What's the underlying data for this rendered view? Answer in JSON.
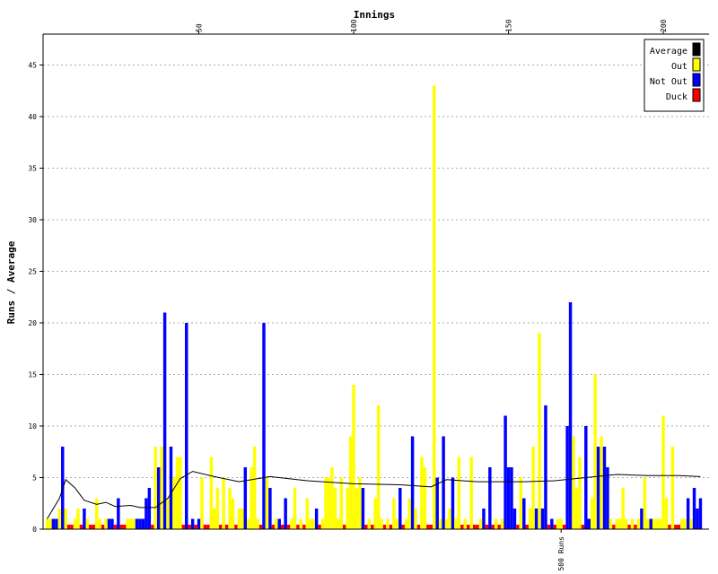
{
  "chart_data": {
    "type": "bar",
    "title": "",
    "xlabel": "Innings",
    "ylabel": "Runs / Average",
    "x_range": [
      1,
      216
    ],
    "ylim": [
      0,
      48
    ],
    "y_ticks": [
      0,
      5,
      10,
      15,
      20,
      25,
      30,
      35,
      40,
      45
    ],
    "x_ticks": [
      50,
      100,
      150,
      200
    ],
    "grid": "horizontal dotted",
    "legend_position": "top-right",
    "legend": [
      {
        "label": "Average",
        "color": "#000000"
      },
      {
        "label": "Out",
        "color": "#ffff00"
      },
      {
        "label": "Not Out",
        "color": "#0000ff"
      },
      {
        "label": "Duck",
        "color": "#ff0000"
      }
    ],
    "annotations": [
      {
        "text": "500 Runs",
        "innings": 167
      }
    ],
    "innings": [
      {
        "n": 1,
        "type": "Out",
        "runs": 1
      },
      {
        "n": 2,
        "type": "Out",
        "runs": 1
      },
      {
        "n": 3,
        "type": "Not Out",
        "runs": 1
      },
      {
        "n": 4,
        "type": "Not Out",
        "runs": 1
      },
      {
        "n": 5,
        "type": "Out",
        "runs": 2
      },
      {
        "n": 6,
        "type": "Not Out",
        "runs": 8
      },
      {
        "n": 7,
        "type": "Out",
        "runs": 2
      },
      {
        "n": 8,
        "type": "Duck",
        "runs": 0
      },
      {
        "n": 9,
        "type": "Duck",
        "runs": 0
      },
      {
        "n": 10,
        "type": "Out",
        "runs": 1
      },
      {
        "n": 11,
        "type": "Out",
        "runs": 2
      },
      {
        "n": 12,
        "type": "Duck",
        "runs": 0
      },
      {
        "n": 13,
        "type": "Not Out",
        "runs": 2
      },
      {
        "n": 14,
        "type": "Out",
        "runs": 1
      },
      {
        "n": 15,
        "type": "Duck",
        "runs": 0
      },
      {
        "n": 16,
        "type": "Duck",
        "runs": 0
      },
      {
        "n": 17,
        "type": "Out",
        "runs": 3
      },
      {
        "n": 18,
        "type": "Out",
        "runs": 1
      },
      {
        "n": 19,
        "type": "Duck",
        "runs": 0
      },
      {
        "n": 20,
        "type": "Out",
        "runs": 1
      },
      {
        "n": 21,
        "type": "Not Out",
        "runs": 1
      },
      {
        "n": 22,
        "type": "Not Out",
        "runs": 1
      },
      {
        "n": 23,
        "type": "Duck",
        "runs": 0
      },
      {
        "n": 24,
        "type": "Not Out",
        "runs": 3
      },
      {
        "n": 25,
        "type": "Duck",
        "runs": 0
      },
      {
        "n": 26,
        "type": "Duck",
        "runs": 0
      },
      {
        "n": 27,
        "type": "Out",
        "runs": 1
      },
      {
        "n": 28,
        "type": "Out",
        "runs": 1
      },
      {
        "n": 29,
        "type": "Out",
        "runs": 1
      },
      {
        "n": 30,
        "type": "Not Out",
        "runs": 1
      },
      {
        "n": 31,
        "type": "Not Out",
        "runs": 1
      },
      {
        "n": 32,
        "type": "Not Out",
        "runs": 1
      },
      {
        "n": 33,
        "type": "Not Out",
        "runs": 3
      },
      {
        "n": 34,
        "type": "Not Out",
        "runs": 4
      },
      {
        "n": 35,
        "type": "Duck",
        "runs": 0
      },
      {
        "n": 36,
        "type": "Out",
        "runs": 8
      },
      {
        "n": 37,
        "type": "Not Out",
        "runs": 6
      },
      {
        "n": 38,
        "type": "Out",
        "runs": 8
      },
      {
        "n": 39,
        "type": "Not Out",
        "runs": 21
      },
      {
        "n": 40,
        "type": "Out",
        "runs": 3
      },
      {
        "n": 41,
        "type": "Not Out",
        "runs": 8
      },
      {
        "n": 42,
        "type": "Out",
        "runs": 5
      },
      {
        "n": 43,
        "type": "Out",
        "runs": 7
      },
      {
        "n": 44,
        "type": "Out",
        "runs": 7
      },
      {
        "n": 45,
        "type": "Duck",
        "runs": 0
      },
      {
        "n": 46,
        "type": "Not Out",
        "runs": 20
      },
      {
        "n": 47,
        "type": "Duck",
        "runs": 0
      },
      {
        "n": 48,
        "type": "Not Out",
        "runs": 1
      },
      {
        "n": 49,
        "type": "Duck",
        "runs": 0
      },
      {
        "n": 50,
        "type": "Not Out",
        "runs": 1
      },
      {
        "n": 51,
        "type": "Out",
        "runs": 5
      },
      {
        "n": 52,
        "type": "Duck",
        "runs": 0
      },
      {
        "n": 53,
        "type": "Duck",
        "runs": 0
      },
      {
        "n": 54,
        "type": "Out",
        "runs": 7
      },
      {
        "n": 55,
        "type": "Out",
        "runs": 2
      },
      {
        "n": 56,
        "type": "Out",
        "runs": 4
      },
      {
        "n": 57,
        "type": "Duck",
        "runs": 0
      },
      {
        "n": 58,
        "type": "Out",
        "runs": 5
      },
      {
        "n": 59,
        "type": "Duck",
        "runs": 0
      },
      {
        "n": 60,
        "type": "Out",
        "runs": 4
      },
      {
        "n": 61,
        "type": "Out",
        "runs": 3
      },
      {
        "n": 62,
        "type": "Duck",
        "runs": 0
      },
      {
        "n": 63,
        "type": "Out",
        "runs": 2
      },
      {
        "n": 64,
        "type": "Out",
        "runs": 2
      },
      {
        "n": 65,
        "type": "Not Out",
        "runs": 6
      },
      {
        "n": 66,
        "type": "Out",
        "runs": 1
      },
      {
        "n": 67,
        "type": "Out",
        "runs": 6
      },
      {
        "n": 68,
        "type": "Out",
        "runs": 8
      },
      {
        "n": 69,
        "type": "Out",
        "runs": 1
      },
      {
        "n": 70,
        "type": "Duck",
        "runs": 0
      },
      {
        "n": 71,
        "type": "Not Out",
        "runs": 20
      },
      {
        "n": 72,
        "type": "Out",
        "runs": 5
      },
      {
        "n": 73,
        "type": "Not Out",
        "runs": 4
      },
      {
        "n": 74,
        "type": "Duck",
        "runs": 0
      },
      {
        "n": 75,
        "type": "Out",
        "runs": 1
      },
      {
        "n": 76,
        "type": "Not Out",
        "runs": 1
      },
      {
        "n": 77,
        "type": "Duck",
        "runs": 0
      },
      {
        "n": 78,
        "type": "Not Out",
        "runs": 3
      },
      {
        "n": 79,
        "type": "Duck",
        "runs": 0
      },
      {
        "n": 80,
        "type": "Out",
        "runs": 1
      },
      {
        "n": 81,
        "type": "Out",
        "runs": 4
      },
      {
        "n": 82,
        "type": "Duck",
        "runs": 0
      },
      {
        "n": 83,
        "type": "Out",
        "runs": 1
      },
      {
        "n": 84,
        "type": "Duck",
        "runs": 0
      },
      {
        "n": 85,
        "type": "Out",
        "runs": 3
      },
      {
        "n": 86,
        "type": "Out",
        "runs": 1
      },
      {
        "n": 87,
        "type": "Out",
        "runs": 1
      },
      {
        "n": 88,
        "type": "Not Out",
        "runs": 2
      },
      {
        "n": 89,
        "type": "Duck",
        "runs": 0
      },
      {
        "n": 90,
        "type": "Out",
        "runs": 1
      },
      {
        "n": 91,
        "type": "Out",
        "runs": 5
      },
      {
        "n": 92,
        "type": "Out",
        "runs": 5
      },
      {
        "n": 93,
        "type": "Out",
        "runs": 6
      },
      {
        "n": 94,
        "type": "Out",
        "runs": 4
      },
      {
        "n": 95,
        "type": "Out",
        "runs": 1
      },
      {
        "n": 96,
        "type": "Out",
        "runs": 5
      },
      {
        "n": 97,
        "type": "Duck",
        "runs": 0
      },
      {
        "n": 98,
        "type": "Out",
        "runs": 4
      },
      {
        "n": 99,
        "type": "Out",
        "runs": 9
      },
      {
        "n": 100,
        "type": "Out",
        "runs": 14
      },
      {
        "n": 101,
        "type": "Out",
        "runs": 4
      },
      {
        "n": 102,
        "type": "Out",
        "runs": 5
      },
      {
        "n": 103,
        "type": "Not Out",
        "runs": 4
      },
      {
        "n": 104,
        "type": "Duck",
        "runs": 0
      },
      {
        "n": 105,
        "type": "Out",
        "runs": 1
      },
      {
        "n": 106,
        "type": "Duck",
        "runs": 0
      },
      {
        "n": 107,
        "type": "Out",
        "runs": 3
      },
      {
        "n": 108,
        "type": "Out",
        "runs": 12
      },
      {
        "n": 109,
        "type": "Out",
        "runs": 1
      },
      {
        "n": 110,
        "type": "Duck",
        "runs": 0
      },
      {
        "n": 111,
        "type": "Out",
        "runs": 1
      },
      {
        "n": 112,
        "type": "Duck",
        "runs": 0
      },
      {
        "n": 113,
        "type": "Out",
        "runs": 3
      },
      {
        "n": 114,
        "type": "Out",
        "runs": 1
      },
      {
        "n": 115,
        "type": "Not Out",
        "runs": 4
      },
      {
        "n": 116,
        "type": "Duck",
        "runs": 0
      },
      {
        "n": 117,
        "type": "Out",
        "runs": 1
      },
      {
        "n": 118,
        "type": "Out",
        "runs": 3
      },
      {
        "n": 119,
        "type": "Not Out",
        "runs": 9
      },
      {
        "n": 120,
        "type": "Out",
        "runs": 2
      },
      {
        "n": 121,
        "type": "Duck",
        "runs": 0
      },
      {
        "n": 122,
        "type": "Out",
        "runs": 7
      },
      {
        "n": 123,
        "type": "Out",
        "runs": 6
      },
      {
        "n": 124,
        "type": "Duck",
        "runs": 0
      },
      {
        "n": 125,
        "type": "Duck",
        "runs": 0
      },
      {
        "n": 126,
        "type": "Out",
        "runs": 43
      },
      {
        "n": 127,
        "type": "Not Out",
        "runs": 5
      },
      {
        "n": 128,
        "type": "Out",
        "runs": 1
      },
      {
        "n": 129,
        "type": "Not Out",
        "runs": 9
      },
      {
        "n": 130,
        "type": "Out",
        "runs": 1
      },
      {
        "n": 131,
        "type": "Out",
        "runs": 2
      },
      {
        "n": 132,
        "type": "Not Out",
        "runs": 5
      },
      {
        "n": 133,
        "type": "Out",
        "runs": 1
      },
      {
        "n": 134,
        "type": "Out",
        "runs": 7
      },
      {
        "n": 135,
        "type": "Duck",
        "runs": 0
      },
      {
        "n": 136,
        "type": "Out",
        "runs": 1
      },
      {
        "n": 137,
        "type": "Duck",
        "runs": 0
      },
      {
        "n": 138,
        "type": "Out",
        "runs": 7
      },
      {
        "n": 139,
        "type": "Duck",
        "runs": 0
      },
      {
        "n": 140,
        "type": "Duck",
        "runs": 0
      },
      {
        "n": 141,
        "type": "Out",
        "runs": 1
      },
      {
        "n": 142,
        "type": "Not Out",
        "runs": 2
      },
      {
        "n": 143,
        "type": "Duck",
        "runs": 0
      },
      {
        "n": 144,
        "type": "Not Out",
        "runs": 6
      },
      {
        "n": 145,
        "type": "Duck",
        "runs": 0
      },
      {
        "n": 146,
        "type": "Out",
        "runs": 1
      },
      {
        "n": 147,
        "type": "Duck",
        "runs": 0
      },
      {
        "n": 148,
        "type": "Out",
        "runs": 1
      },
      {
        "n": 149,
        "type": "Not Out",
        "runs": 11
      },
      {
        "n": 150,
        "type": "Not Out",
        "runs": 6
      },
      {
        "n": 151,
        "type": "Not Out",
        "runs": 6
      },
      {
        "n": 152,
        "type": "Not Out",
        "runs": 2
      },
      {
        "n": 153,
        "type": "Duck",
        "runs": 0
      },
      {
        "n": 154,
        "type": "Out",
        "runs": 5
      },
      {
        "n": 155,
        "type": "Not Out",
        "runs": 3
      },
      {
        "n": 156,
        "type": "Duck",
        "runs": 0
      },
      {
        "n": 157,
        "type": "Out",
        "runs": 2
      },
      {
        "n": 158,
        "type": "Out",
        "runs": 8
      },
      {
        "n": 159,
        "type": "Not Out",
        "runs": 2
      },
      {
        "n": 160,
        "type": "Out",
        "runs": 19
      },
      {
        "n": 161,
        "type": "Not Out",
        "runs": 2
      },
      {
        "n": 162,
        "type": "Not Out",
        "runs": 12
      },
      {
        "n": 163,
        "type": "Duck",
        "runs": 0
      },
      {
        "n": 164,
        "type": "Not Out",
        "runs": 1
      },
      {
        "n": 165,
        "type": "Duck",
        "runs": 0
      },
      {
        "n": 166,
        "type": "Out",
        "runs": 1
      },
      {
        "n": 167,
        "type": "Out",
        "runs": 1
      },
      {
        "n": 168,
        "type": "Duck",
        "runs": 0
      },
      {
        "n": 169,
        "type": "Not Out",
        "runs": 10
      },
      {
        "n": 170,
        "type": "Not Out",
        "runs": 22
      },
      {
        "n": 171,
        "type": "Out",
        "runs": 9
      },
      {
        "n": 172,
        "type": "Out",
        "runs": 4
      },
      {
        "n": 173,
        "type": "Out",
        "runs": 7
      },
      {
        "n": 174,
        "type": "Duck",
        "runs": 0
      },
      {
        "n": 175,
        "type": "Not Out",
        "runs": 10
      },
      {
        "n": 176,
        "type": "Not Out",
        "runs": 1
      },
      {
        "n": 177,
        "type": "Out",
        "runs": 3
      },
      {
        "n": 178,
        "type": "Out",
        "runs": 15
      },
      {
        "n": 179,
        "type": "Not Out",
        "runs": 8
      },
      {
        "n": 180,
        "type": "Out",
        "runs": 9
      },
      {
        "n": 181,
        "type": "Not Out",
        "runs": 8
      },
      {
        "n": 182,
        "type": "Not Out",
        "runs": 6
      },
      {
        "n": 183,
        "type": "Out",
        "runs": 1
      },
      {
        "n": 184,
        "type": "Duck",
        "runs": 0
      },
      {
        "n": 185,
        "type": "Out",
        "runs": 1
      },
      {
        "n": 186,
        "type": "Out",
        "runs": 1
      },
      {
        "n": 187,
        "type": "Out",
        "runs": 4
      },
      {
        "n": 188,
        "type": "Out",
        "runs": 1
      },
      {
        "n": 189,
        "type": "Duck",
        "runs": 0
      },
      {
        "n": 190,
        "type": "Out",
        "runs": 1
      },
      {
        "n": 191,
        "type": "Duck",
        "runs": 0
      },
      {
        "n": 192,
        "type": "Out",
        "runs": 1
      },
      {
        "n": 193,
        "type": "Not Out",
        "runs": 2
      },
      {
        "n": 194,
        "type": "Out",
        "runs": 5
      },
      {
        "n": 195,
        "type": "Out",
        "runs": 1
      },
      {
        "n": 196,
        "type": "Not Out",
        "runs": 1
      },
      {
        "n": 197,
        "type": "Out",
        "runs": 1
      },
      {
        "n": 198,
        "type": "Out",
        "runs": 1
      },
      {
        "n": 199,
        "type": "Out",
        "runs": 1
      },
      {
        "n": 200,
        "type": "Out",
        "runs": 11
      },
      {
        "n": 201,
        "type": "Out",
        "runs": 3
      },
      {
        "n": 202,
        "type": "Duck",
        "runs": 0
      },
      {
        "n": 203,
        "type": "Out",
        "runs": 8
      },
      {
        "n": 204,
        "type": "Duck",
        "runs": 0
      },
      {
        "n": 205,
        "type": "Duck",
        "runs": 0
      },
      {
        "n": 206,
        "type": "Out",
        "runs": 1
      },
      {
        "n": 207,
        "type": "Out",
        "runs": 1
      },
      {
        "n": 208,
        "type": "Not Out",
        "runs": 3
      },
      {
        "n": 209,
        "type": "Out",
        "runs": 1
      },
      {
        "n": 210,
        "type": "Not Out",
        "runs": 4
      },
      {
        "n": 211,
        "type": "Not Out",
        "runs": 2
      },
      {
        "n": 212,
        "type": "Not Out",
        "runs": 3
      }
    ],
    "average_line": [
      {
        "innings": 1,
        "avg": 1
      },
      {
        "innings": 5,
        "avg": 3
      },
      {
        "innings": 7,
        "avg": 4.8
      },
      {
        "innings": 10,
        "avg": 4
      },
      {
        "innings": 13,
        "avg": 2.8
      },
      {
        "innings": 17,
        "avg": 2.4
      },
      {
        "innings": 20,
        "avg": 2.6
      },
      {
        "innings": 23,
        "avg": 2.2
      },
      {
        "innings": 28,
        "avg": 2.3
      },
      {
        "innings": 31,
        "avg": 2.1
      },
      {
        "innings": 36,
        "avg": 2.1
      },
      {
        "innings": 40,
        "avg": 3
      },
      {
        "innings": 44,
        "avg": 4.9
      },
      {
        "innings": 48,
        "avg": 5.6
      },
      {
        "innings": 55,
        "avg": 5.1
      },
      {
        "innings": 63,
        "avg": 4.6
      },
      {
        "innings": 73,
        "avg": 5.1
      },
      {
        "innings": 85,
        "avg": 4.7
      },
      {
        "innings": 100,
        "avg": 4.4
      },
      {
        "innings": 115,
        "avg": 4.3
      },
      {
        "innings": 125,
        "avg": 4.1
      },
      {
        "innings": 130,
        "avg": 4.8
      },
      {
        "innings": 140,
        "avg": 4.6
      },
      {
        "innings": 155,
        "avg": 4.6
      },
      {
        "innings": 165,
        "avg": 4.7
      },
      {
        "innings": 175,
        "avg": 5
      },
      {
        "innings": 185,
        "avg": 5.3
      },
      {
        "innings": 195,
        "avg": 5.2
      },
      {
        "innings": 205,
        "avg": 5.2
      },
      {
        "innings": 212,
        "avg": 5.1
      }
    ]
  }
}
